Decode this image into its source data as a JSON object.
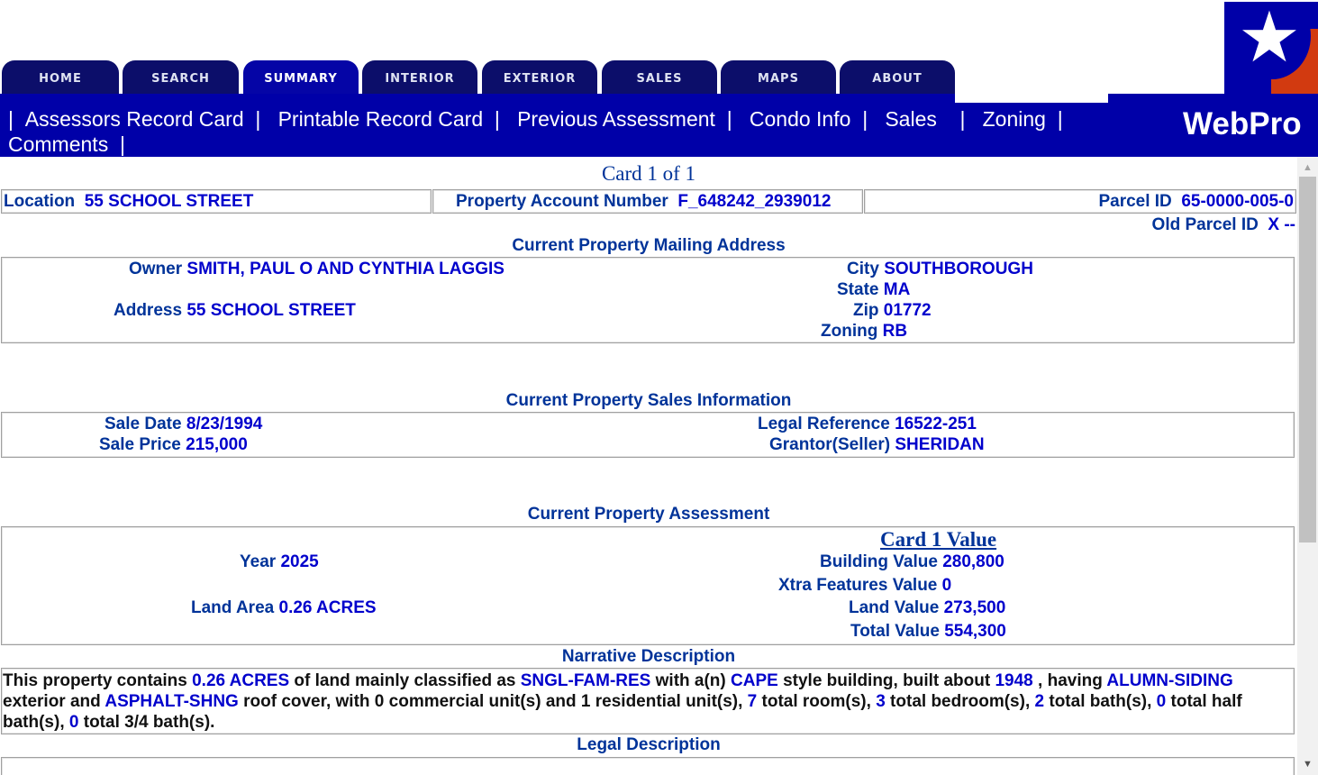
{
  "tabs": [
    "HOME",
    "SEARCH",
    "SUMMARY",
    "INTERIOR",
    "EXTERIOR",
    "SALES",
    "MAPS",
    "ABOUT"
  ],
  "nav": {
    "sep": "|",
    "links": [
      "Assessors Record Card",
      "Printable Record Card",
      "Previous Assessment",
      "Condo Info",
      "Sales",
      "Zoning",
      "Comments"
    ]
  },
  "brand": {
    "name": "WebPro",
    "logo_icon": "star-icon",
    "colors": {
      "navy": "#0000a8",
      "tab": "#0c0e6a",
      "red": "#d23a10"
    }
  },
  "card": {
    "title": "Card 1 of 1"
  },
  "header_row": {
    "location_label": "Location",
    "location_value": "55 SCHOOL STREET",
    "account_label": "Property Account Number",
    "account_value": "F_648242_2939012",
    "parcel_label": "Parcel ID",
    "parcel_value": "65-0000-005-0",
    "old_parcel_label": "Old Parcel ID",
    "old_parcel_value": "X --"
  },
  "mailing": {
    "title": "Current Property Mailing Address",
    "owner_label": "Owner",
    "owner_value": "SMITH, PAUL O AND CYNTHIA LAGGIS",
    "address_label": "Address",
    "address_value": "55 SCHOOL STREET",
    "city_label": "City",
    "city_value": "SOUTHBOROUGH",
    "state_label": "State",
    "state_value": "MA",
    "zip_label": "Zip",
    "zip_value": "01772",
    "zoning_label": "Zoning",
    "zoning_value": "RB"
  },
  "sales": {
    "title": "Current Property Sales Information",
    "sale_date_label": "Sale Date",
    "sale_date_value": "8/23/1994",
    "sale_price_label": "Sale Price",
    "sale_price_value": "215,000",
    "legal_ref_label": "Legal Reference",
    "legal_ref_value": "16522-251",
    "grantor_label": "Grantor(Seller)",
    "grantor_value": "SHERIDAN"
  },
  "assessment": {
    "title": "Current Property Assessment",
    "card_value_title": "Card 1 Value",
    "year_label": "Year",
    "year_value": "2025",
    "land_area_label": "Land Area",
    "land_area_value": "0.26 ACRES",
    "building_label": "Building Value",
    "building_value": "280,800",
    "xtra_label": "Xtra Features Value",
    "xtra_value": "0",
    "land_value_label": "Land Value",
    "land_value_value": "273,500",
    "total_label": "Total Value",
    "total_value": "554,300"
  },
  "narrative": {
    "title": "Narrative Description",
    "t1": "This property contains ",
    "acres": "0.26 ACRES",
    "t2": " of land mainly classified as ",
    "class": "SNGL-FAM-RES",
    "t3": " with a(n) ",
    "style": "CAPE",
    "t4": " style building, built about ",
    "year": "1948",
    "t5": " , having ",
    "siding": "ALUMN-SIDING",
    "t6": " exterior and ",
    "roof": "ASPHALT-SHNG",
    "t7": " roof cover, with 0 commercial unit(s) and 1 residential unit(s), ",
    "rooms": "7",
    "t8": " total room(s), ",
    "bedrooms": "3",
    "t9": " total bedroom(s), ",
    "baths": "2",
    "t10": " total bath(s), ",
    "half": "0",
    "t11": " total half bath(s), ",
    "threequarter": "0",
    "t12": " total 3/4 bath(s)."
  },
  "legal": {
    "title": "Legal Description"
  }
}
